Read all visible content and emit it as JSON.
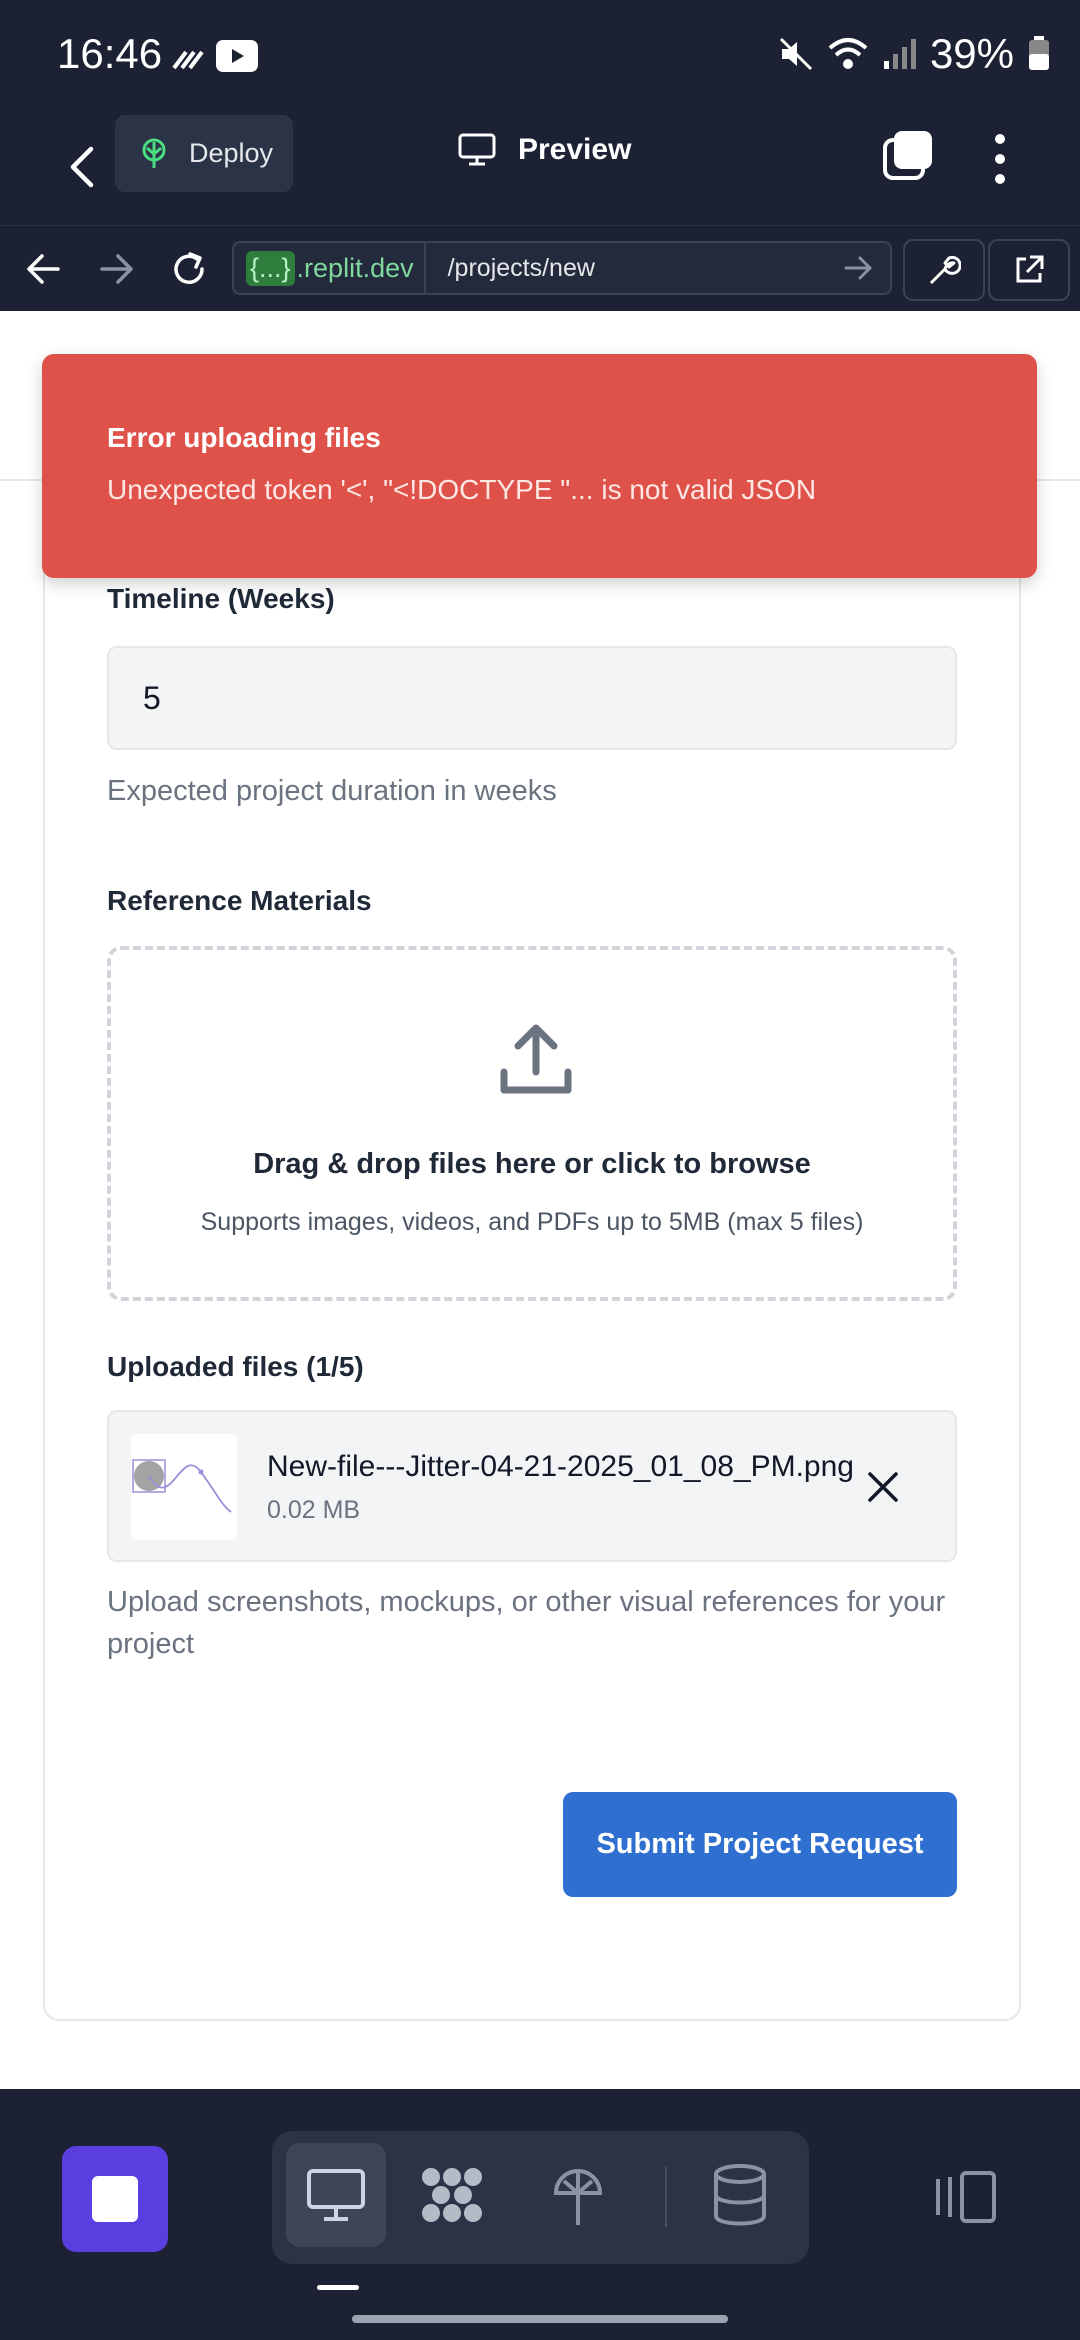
{
  "status_bar": {
    "time": "16:46",
    "battery": "39%"
  },
  "app_bar": {
    "deploy_label": "Deploy",
    "title": "Preview"
  },
  "url_bar": {
    "host_brace": "{...}",
    "host": ".replit.dev",
    "path": "/projects/new"
  },
  "toast": {
    "title": "Error uploading files",
    "message": "Unexpected token '<', \"<!DOCTYPE \"... is not valid JSON"
  },
  "form": {
    "timeline": {
      "label": "Timeline (Weeks)",
      "value": "5",
      "helper": "Expected project duration in weeks"
    },
    "reference": {
      "label": "Reference Materials",
      "drop_title": "Drag & drop files here or click to browse",
      "drop_subtitle": "Supports images, videos, and PDFs up to 5MB (max 5 files)",
      "uploaded_label": "Uploaded files (1/5)",
      "files": [
        {
          "name": "New-file---Jitter-04-21-2025_01_08_PM.png",
          "size": "0.02 MB"
        }
      ],
      "helper": "Upload screenshots, mockups, or other visual references for your project"
    },
    "submit_label": "Submit Project Request"
  },
  "colors": {
    "accent": "#2f6fd0",
    "error": "#df5249",
    "chrome": "#1c2233",
    "stop": "#5b3ee0"
  }
}
